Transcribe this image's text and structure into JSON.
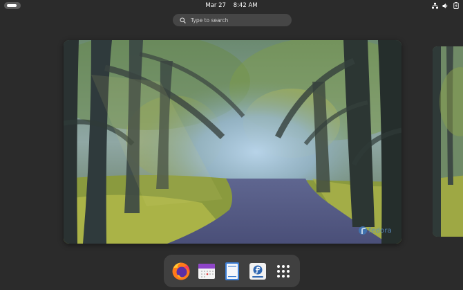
{
  "topbar": {
    "date": "Mar 27",
    "time": "8:42 AM",
    "tray_icons": [
      "network-icon",
      "volume-icon",
      "battery-icon"
    ]
  },
  "search": {
    "placeholder": "Type to search"
  },
  "workspace": {
    "watermark": "fedora"
  },
  "dash": {
    "apps": [
      "firefox-icon",
      "calendar-icon",
      "text-editor-icon",
      "software-icon",
      "app-grid-icon"
    ]
  },
  "colors": {
    "background": "#2b2b2b",
    "dash": "#404040",
    "search": "#464646",
    "accent_blue": "#3f76b4"
  }
}
